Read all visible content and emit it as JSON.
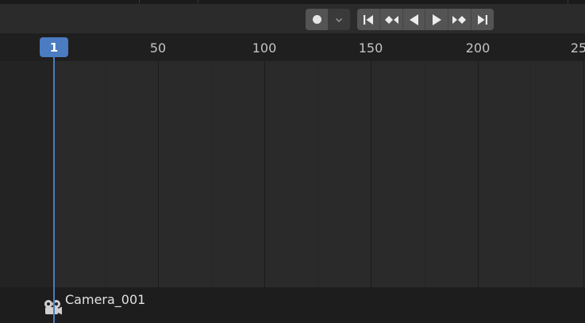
{
  "transport": {
    "record_icon": "record-dot-icon",
    "record_menu_icon": "chevron-down-icon",
    "buttons": [
      {
        "name": "jump-to-start-button",
        "icon": "jump-start-icon"
      },
      {
        "name": "jump-to-previous-keyframe-button",
        "icon": "prev-keyframe-icon"
      },
      {
        "name": "play-reverse-button",
        "icon": "play-reverse-icon"
      },
      {
        "name": "play-button",
        "icon": "play-icon"
      },
      {
        "name": "jump-to-next-keyframe-button",
        "icon": "next-keyframe-icon"
      },
      {
        "name": "jump-to-end-button",
        "icon": "jump-end-icon"
      }
    ]
  },
  "ruler": {
    "labels": [
      "50",
      "100",
      "150",
      "200",
      "25"
    ]
  },
  "playhead": {
    "frame": "1"
  },
  "footer": {
    "object_label": "Camera_001",
    "object_icon": "camera-icon"
  },
  "colors": {
    "playhead": "#4b7bc1",
    "background": "#2a2a2a",
    "header": "#2b2b2b"
  }
}
